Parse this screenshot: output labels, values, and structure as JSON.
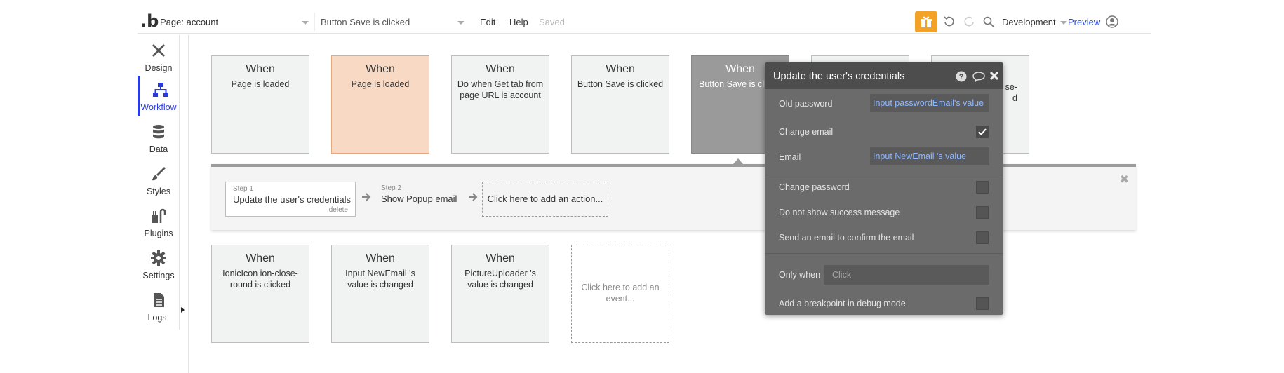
{
  "topbar": {
    "logo": "b",
    "page_select": "Page: account",
    "event_select": "Button Save is clicked",
    "menu_edit": "Edit",
    "menu_help": "Help",
    "status": "Saved",
    "environment": "Development",
    "preview": "Preview",
    "accent_color": "#f2a227"
  },
  "sidebar": {
    "items": [
      {
        "label": "Design",
        "icon": "design-tools-icon"
      },
      {
        "label": "Workflow",
        "icon": "workflow-icon",
        "active": true
      },
      {
        "label": "Data",
        "icon": "database-icon"
      },
      {
        "label": "Styles",
        "icon": "brush-icon"
      },
      {
        "label": "Plugins",
        "icon": "plugin-icon"
      },
      {
        "label": "Settings",
        "icon": "gear-icon"
      },
      {
        "label": "Logs",
        "icon": "document-icon"
      }
    ],
    "active_color": "#2b3bd8"
  },
  "events_row1": [
    {
      "when": "When",
      "desc": "Page is loaded",
      "style": "default"
    },
    {
      "when": "When",
      "desc": "Page is loaded",
      "style": "orange"
    },
    {
      "when": "When",
      "desc": "Do when Get tab from page URL is account",
      "style": "default"
    },
    {
      "when": "When",
      "desc": "Button Save is clicked",
      "style": "default"
    },
    {
      "when": "When",
      "desc": "Button Save is clic",
      "style": "dark"
    },
    {
      "when": "",
      "desc": "",
      "style": "default"
    },
    {
      "when": "",
      "desc": "se-\nd",
      "style": "default"
    }
  ],
  "events_row2": [
    {
      "when": "When",
      "desc": "IonicIcon ion-close-round is clicked"
    },
    {
      "when": "When",
      "desc": "Input NewEmail 's value is changed"
    },
    {
      "when": "When",
      "desc": "PictureUploader 's value is changed"
    },
    {
      "when": "",
      "desc": "Click here to add an event..."
    }
  ],
  "actions": {
    "step1": {
      "num": "Step 1",
      "name": "Update the user's credentials",
      "delete": "delete"
    },
    "step2": {
      "num": "Step 2",
      "name": "Show Popup email"
    },
    "add": "Click here to add an action..."
  },
  "editor": {
    "title": "Update the user's credentials",
    "old_password_label": "Old password",
    "old_password_value": "Input passwordEmail's value",
    "change_email_label": "Change email",
    "change_email_checked": true,
    "email_label": "Email",
    "email_value": "Input NewEmail 's value",
    "change_password_label": "Change password",
    "no_success_label": "Do not show success message",
    "send_email_label": "Send an email to confirm the email",
    "only_when_label": "Only when",
    "only_when_placeholder": "Click",
    "breakpoint_label": "Add a breakpoint in debug mode",
    "value_color": "#8fb8ff"
  }
}
